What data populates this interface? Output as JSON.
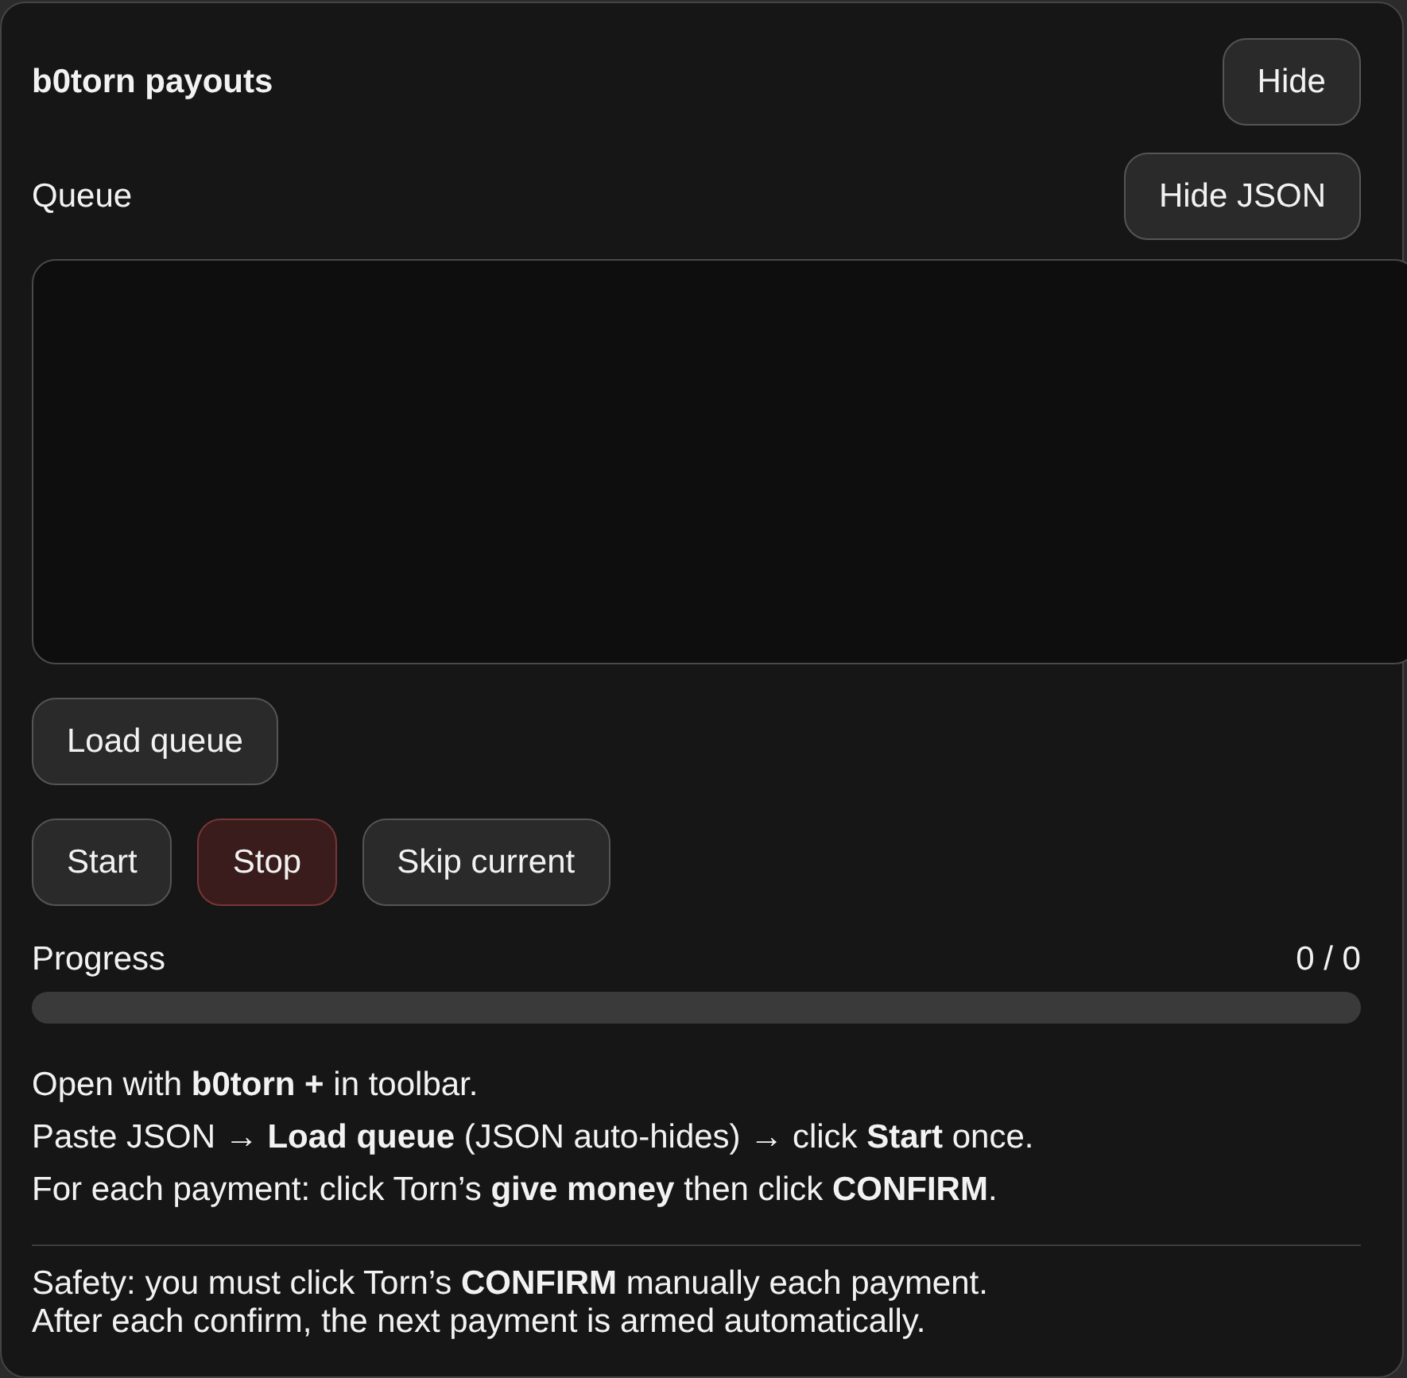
{
  "panel": {
    "title": "b0torn payouts",
    "hide_button": "Hide"
  },
  "queue": {
    "label": "Queue",
    "toggle_button": "Hide JSON"
  },
  "load_button": "Load queue",
  "controls": [
    {
      "label": "Start",
      "kind": "normal"
    },
    {
      "label": "Stop",
      "kind": "danger"
    },
    {
      "label": "Skip current",
      "kind": "normal"
    }
  ],
  "progress": {
    "label": "Progress",
    "reading": "0 / 0",
    "level": 0
  },
  "instructions": [
    "Open with **b0torn +** in toolbar.",
    "Paste JSON → **Load queue** (JSON auto-hides) → click **Start** once.",
    "For each payment: click Torn’s **give money** then click **CONFIRM**."
  ],
  "safety": [
    "Safety: you must click Torn’s **CONFIRM** manually each payment.",
    "After each confirm, the next payment is armed automatically."
  ]
}
